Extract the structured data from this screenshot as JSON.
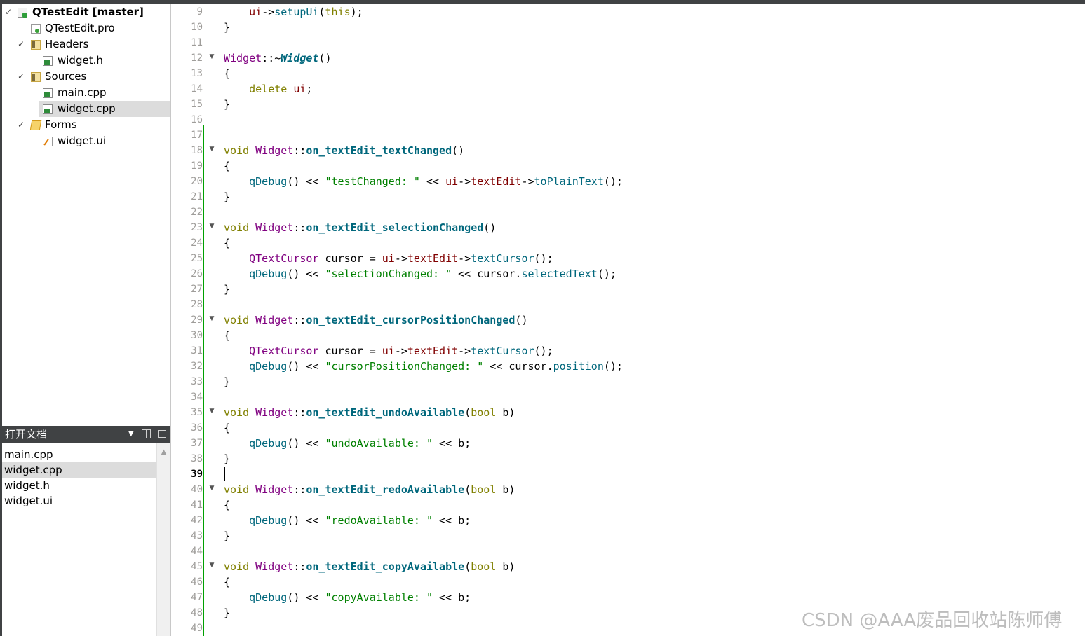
{
  "project_tree": {
    "project": "QTestEdit [master]",
    "pro_file": "QTestEdit.pro",
    "headers_label": "Headers",
    "headers": [
      "widget.h"
    ],
    "sources_label": "Sources",
    "sources": [
      "main.cpp",
      "widget.cpp"
    ],
    "forms_label": "Forms",
    "forms": [
      "widget.ui"
    ],
    "selected": "widget.cpp"
  },
  "open_documents": {
    "title": "打开文档",
    "items": [
      "main.cpp",
      "widget.cpp",
      "widget.h",
      "widget.ui"
    ],
    "selected": "widget.cpp"
  },
  "editor": {
    "current_line": 39,
    "lines": [
      {
        "n": "9",
        "fold": false,
        "code": "    ui->setupUi(this);"
      },
      {
        "n": "10",
        "fold": false,
        "code": "}"
      },
      {
        "n": "11",
        "fold": false,
        "code": ""
      },
      {
        "n": "12",
        "fold": true,
        "code": "Widget::~Widget()"
      },
      {
        "n": "13",
        "fold": false,
        "code": "{"
      },
      {
        "n": "14",
        "fold": false,
        "code": "    delete ui;"
      },
      {
        "n": "15",
        "fold": false,
        "code": "}"
      },
      {
        "n": "16",
        "fold": false,
        "code": ""
      },
      {
        "n": "17",
        "fold": false,
        "code": ""
      },
      {
        "n": "18",
        "fold": true,
        "code": "void Widget::on_textEdit_textChanged()"
      },
      {
        "n": "19",
        "fold": false,
        "code": "{"
      },
      {
        "n": "20",
        "fold": false,
        "code": "    qDebug() << \"testChanged: \" << ui->textEdit->toPlainText();"
      },
      {
        "n": "21",
        "fold": false,
        "code": "}"
      },
      {
        "n": "22",
        "fold": false,
        "code": ""
      },
      {
        "n": "23",
        "fold": true,
        "code": "void Widget::on_textEdit_selectionChanged()"
      },
      {
        "n": "24",
        "fold": false,
        "code": "{"
      },
      {
        "n": "25",
        "fold": false,
        "code": "    QTextCursor cursor = ui->textEdit->textCursor();"
      },
      {
        "n": "26",
        "fold": false,
        "code": "    qDebug() << \"selectionChanged: \" << cursor.selectedText();"
      },
      {
        "n": "27",
        "fold": false,
        "code": "}"
      },
      {
        "n": "28",
        "fold": false,
        "code": ""
      },
      {
        "n": "29",
        "fold": true,
        "code": "void Widget::on_textEdit_cursorPositionChanged()"
      },
      {
        "n": "30",
        "fold": false,
        "code": "{"
      },
      {
        "n": "31",
        "fold": false,
        "code": "    QTextCursor cursor = ui->textEdit->textCursor();"
      },
      {
        "n": "32",
        "fold": false,
        "code": "    qDebug() << \"cursorPositionChanged: \" << cursor.position();"
      },
      {
        "n": "33",
        "fold": false,
        "code": "}"
      },
      {
        "n": "34",
        "fold": false,
        "code": ""
      },
      {
        "n": "35",
        "fold": true,
        "code": "void Widget::on_textEdit_undoAvailable(bool b)"
      },
      {
        "n": "36",
        "fold": false,
        "code": "{"
      },
      {
        "n": "37",
        "fold": false,
        "code": "    qDebug() << \"undoAvailable: \" << b;"
      },
      {
        "n": "38",
        "fold": false,
        "code": "}"
      },
      {
        "n": "39",
        "fold": false,
        "code": ""
      },
      {
        "n": "40",
        "fold": true,
        "code": "void Widget::on_textEdit_redoAvailable(bool b)"
      },
      {
        "n": "41",
        "fold": false,
        "code": "{"
      },
      {
        "n": "42",
        "fold": false,
        "code": "    qDebug() << \"redoAvailable: \" << b;"
      },
      {
        "n": "43",
        "fold": false,
        "code": "}"
      },
      {
        "n": "44",
        "fold": false,
        "code": ""
      },
      {
        "n": "45",
        "fold": true,
        "code": "void Widget::on_textEdit_copyAvailable(bool b)"
      },
      {
        "n": "46",
        "fold": false,
        "code": "{"
      },
      {
        "n": "47",
        "fold": false,
        "code": "    qDebug() << \"copyAvailable: \" << b;"
      },
      {
        "n": "48",
        "fold": false,
        "code": "}"
      },
      {
        "n": "49",
        "fold": false,
        "code": ""
      }
    ]
  },
  "watermark": "CSDN @AAA废品回收站陈师傅",
  "colors": {
    "keyword": "#808000",
    "type": "#800080",
    "function": "#00677c",
    "string": "#008000",
    "member": "#800000",
    "line_number": "#9f9d9a",
    "modified_bar": "#00a000",
    "panel_header": "#404244"
  }
}
